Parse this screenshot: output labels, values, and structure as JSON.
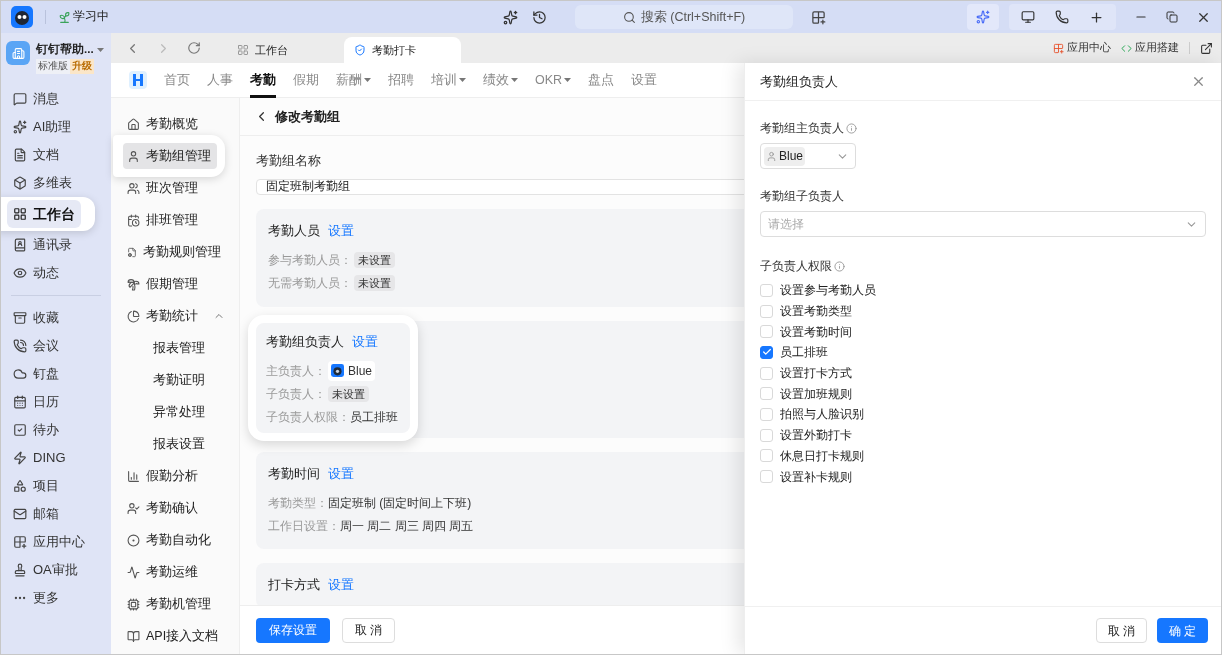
{
  "titlebar": {
    "status": "学习中",
    "search": {
      "placeholder": "搜索 (Ctrl+Shift+F)"
    }
  },
  "org": {
    "name": "钉钉帮助...",
    "edition": "标准版",
    "upgrade": "升级"
  },
  "sidebar": {
    "primary": [
      {
        "label": "消息",
        "selected": false
      },
      {
        "label": "AI助理",
        "selected": false
      },
      {
        "label": "文档",
        "selected": false
      },
      {
        "label": "多维表",
        "selected": false
      },
      {
        "label": "工作台",
        "selected": true
      },
      {
        "label": "通讯录",
        "selected": false
      },
      {
        "label": "动态",
        "selected": false
      }
    ],
    "secondary": [
      {
        "label": "收藏",
        "selected": false
      },
      {
        "label": "会议",
        "selected": false
      },
      {
        "label": "钉盘",
        "selected": false
      },
      {
        "label": "日历",
        "selected": false
      },
      {
        "label": "待办",
        "selected": false
      },
      {
        "label": "DING",
        "selected": false
      },
      {
        "label": "项目",
        "selected": false
      },
      {
        "label": "邮箱",
        "selected": false
      },
      {
        "label": "应用中心",
        "selected": false
      },
      {
        "label": "OA审批",
        "selected": false
      },
      {
        "label": "更多",
        "selected": false
      }
    ]
  },
  "browser_tabs": [
    {
      "label": "工作台",
      "selected": false
    },
    {
      "label": "考勤打卡",
      "selected": true
    }
  ],
  "toolbar_links": [
    "应用中心",
    "应用搭建"
  ],
  "nav": {
    "items": [
      {
        "label": "首页",
        "selected": false,
        "dropdown": false
      },
      {
        "label": "人事",
        "selected": false,
        "dropdown": false
      },
      {
        "label": "考勤",
        "selected": true,
        "dropdown": false
      },
      {
        "label": "假期",
        "selected": false,
        "dropdown": false
      },
      {
        "label": "薪酬",
        "selected": false,
        "dropdown": true
      },
      {
        "label": "招聘",
        "selected": false,
        "dropdown": false
      },
      {
        "label": "培训",
        "selected": false,
        "dropdown": true
      },
      {
        "label": "绩效",
        "selected": false,
        "dropdown": true
      },
      {
        "label": "OKR",
        "selected": false,
        "dropdown": true
      },
      {
        "label": "盘点",
        "selected": false,
        "dropdown": false
      },
      {
        "label": "设置",
        "selected": false,
        "dropdown": false
      }
    ]
  },
  "submenu": [
    {
      "label": "考勤概览",
      "selected": false
    },
    {
      "label": "考勤组管理",
      "selected": true
    },
    {
      "label": "班次管理",
      "selected": false
    },
    {
      "label": "排班管理",
      "selected": false
    },
    {
      "label": "考勤规则管理",
      "selected": false
    },
    {
      "label": "假期管理",
      "selected": false
    },
    {
      "label": "考勤统计",
      "selected": false,
      "expanded": true,
      "children": [
        {
          "label": "报表管理",
          "selected": false
        },
        {
          "label": "考勤证明",
          "selected": false
        },
        {
          "label": "异常处理",
          "selected": false
        },
        {
          "label": "报表设置",
          "selected": false
        }
      ]
    },
    {
      "label": "假勤分析",
      "selected": false
    },
    {
      "label": "考勤确认",
      "selected": false
    },
    {
      "label": "考勤自动化",
      "selected": false
    },
    {
      "label": "考勤运维",
      "selected": false
    },
    {
      "label": "考勤机管理",
      "selected": false
    },
    {
      "label": "API接入文档",
      "selected": false
    }
  ],
  "page": {
    "title": "修改考勤组",
    "name_field": {
      "label": "考勤组名称",
      "value": "固定班制考勤组"
    },
    "cards": [
      {
        "title": "考勤人员",
        "action": "设置",
        "highlighted": false,
        "rows": [
          {
            "label": "参与考勤人员：",
            "kind": "tag",
            "value": "未设置"
          },
          {
            "label": "无需考勤人员：",
            "kind": "tag",
            "value": "未设置"
          }
        ]
      },
      {
        "title": "考勤组负责人",
        "action": "设置",
        "highlighted": true,
        "rows": [
          {
            "label": "主负责人：",
            "kind": "person",
            "value": "Blue"
          },
          {
            "label": "子负责人：",
            "kind": "tag",
            "value": "未设置"
          },
          {
            "label": "子负责人权限：",
            "kind": "text",
            "value": "员工排班"
          }
        ]
      },
      {
        "title": "考勤时间",
        "action": "设置",
        "highlighted": false,
        "rows": [
          {
            "label": "考勤类型：",
            "kind": "text",
            "value": "固定班制 (固定时间上下班)"
          },
          {
            "label": "工作日设置：",
            "kind": "text",
            "value": "周一 周二 周三 周四 周五"
          }
        ]
      },
      {
        "title": "打卡方式",
        "action": "设置",
        "highlighted": false
      }
    ],
    "buttons": [
      "保存设置",
      "取 消"
    ]
  },
  "drawer": {
    "title": "考勤组负责人",
    "main_owner": {
      "label": "考勤组主负责人",
      "value": "Blue"
    },
    "sub_owner": {
      "label": "考勤组子负责人",
      "placeholder": "请选择"
    },
    "permissions": {
      "label": "子负责人权限",
      "options": [
        {
          "label": "设置参与考勤人员",
          "checked": false
        },
        {
          "label": "设置考勤类型",
          "checked": false
        },
        {
          "label": "设置考勤时间",
          "checked": false
        },
        {
          "label": "员工排班",
          "checked": true
        },
        {
          "label": "设置打卡方式",
          "checked": false
        },
        {
          "label": "设置加班规则",
          "checked": false
        },
        {
          "label": "拍照与人脸识别",
          "checked": false
        },
        {
          "label": "设置外勤打卡",
          "checked": false
        },
        {
          "label": "休息日打卡规则",
          "checked": false
        },
        {
          "label": "设置补卡规则",
          "checked": false
        }
      ]
    },
    "buttons": [
      "取 消",
      "确 定"
    ]
  }
}
